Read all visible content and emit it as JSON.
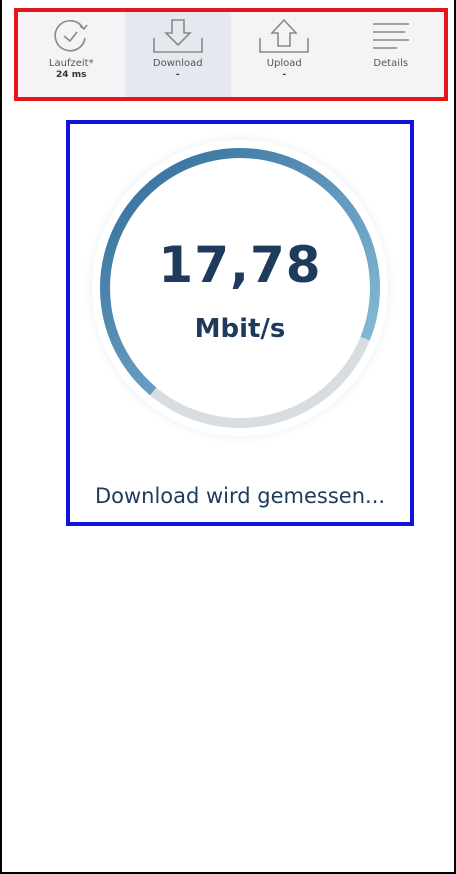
{
  "tabs": [
    {
      "label": "Laufzeit*",
      "value": "24 ms",
      "icon": "gauge-check-icon"
    },
    {
      "label": "Download",
      "value": "-",
      "icon": "download-icon",
      "active": true
    },
    {
      "label": "Upload",
      "value": "-",
      "icon": "upload-icon"
    },
    {
      "label": "Details",
      "value": "",
      "icon": "menu-lines-icon"
    }
  ],
  "gauge": {
    "value": "17,78",
    "unit": "Mbit/s",
    "status": "Download wird gemessen...",
    "progress": 0.7
  },
  "colors": {
    "gauge_start": "#2f6a98",
    "gauge_end": "#8fc3dc",
    "text": "#1e3a5c",
    "highlight_box": "#1212e0",
    "tabbar_box": "#e8141c"
  }
}
